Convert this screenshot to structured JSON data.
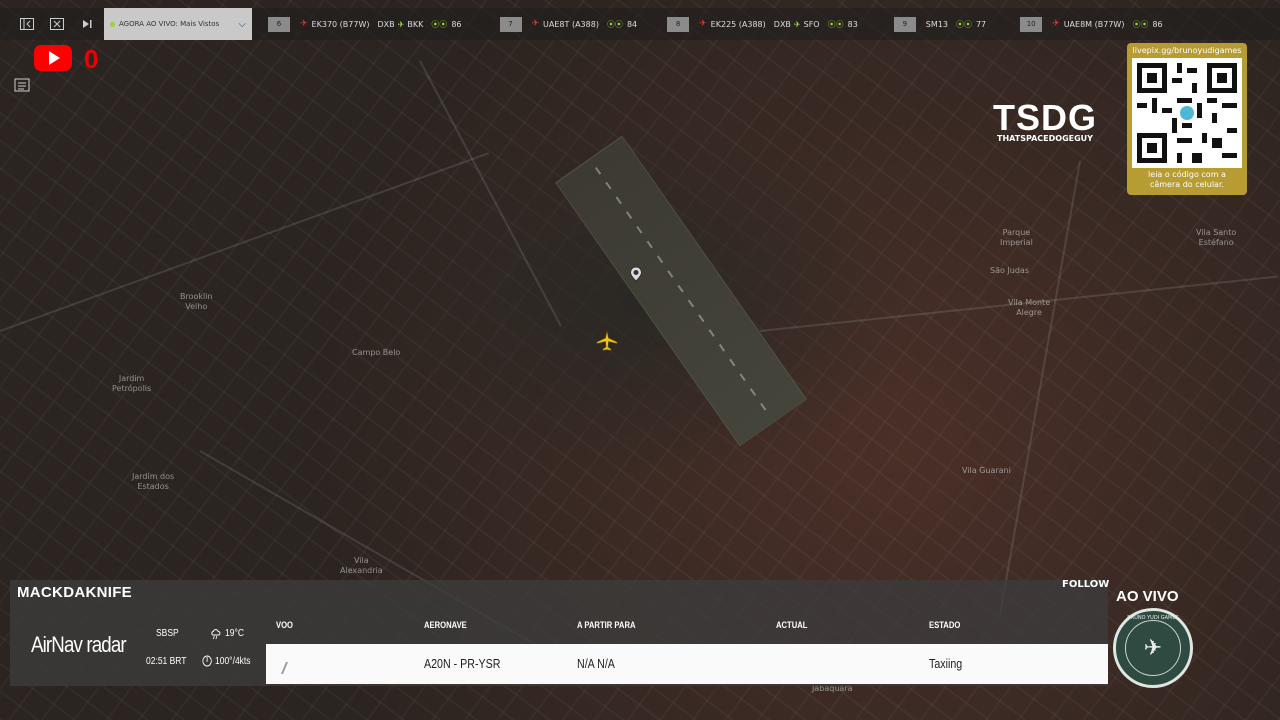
{
  "topbar": {
    "now_live_label": "AGORA AO VIVO: Mais Vistos",
    "flights": [
      {
        "num": "6",
        "code": "EK370 (B77W)",
        "from": "DXB",
        "to": "BKK",
        "count": "86"
      },
      {
        "num": "7",
        "code": "UAE8T (A388)",
        "from": "",
        "to": "",
        "count": "84"
      },
      {
        "num": "8",
        "code": "EK225 (A388)",
        "from": "DXB",
        "to": "SFO",
        "count": "83"
      },
      {
        "num": "9",
        "code": "SM13",
        "from": "",
        "to": "",
        "count": "77"
      },
      {
        "num": "10",
        "code": "UAE8M (B77W)",
        "from": "",
        "to": "",
        "count": "86"
      }
    ]
  },
  "youtube": {
    "count": "0"
  },
  "logo": {
    "main": "TSDG",
    "sub": "THATSPACEDOGEGUY"
  },
  "qr": {
    "url": "livepix.gg/brunoyudigames",
    "caption": "leia o código com a\ncâmera do celular."
  },
  "map_labels": [
    {
      "text": "Brooklin\nVelho"
    },
    {
      "text": "Campo Belo"
    },
    {
      "text": "Jardim\nPetrópolis"
    },
    {
      "text": "Jardim dos\nEstados"
    },
    {
      "text": "Vila\nAlexandria"
    },
    {
      "text": "Parque\nImperial"
    },
    {
      "text": "São Judas"
    },
    {
      "text": "Vila Monte\nAlegre"
    },
    {
      "text": "Vila Guarani"
    },
    {
      "text": "Vila Santo\nEstéfano"
    },
    {
      "text": "Jabaquara"
    }
  ],
  "panel": {
    "callsign": "MACKDAKNIFE",
    "follow": "FOLLOW",
    "brand": "AirNav radar",
    "airport": "SBSP",
    "temp": "19°C",
    "time": "02:51 BRT",
    "wind": "100°/4kts",
    "headers": {
      "flight": "VOO",
      "aircraft": "AERONAVE",
      "from_to": "A PARTIR PARA",
      "actual": "ACTUAL",
      "status": "ESTADO"
    },
    "row": {
      "flight": "",
      "aircraft": "A20N - PR-YSR",
      "from_to": "N/A N/A",
      "actual": "",
      "status": "Taxiing"
    }
  },
  "live": {
    "label": "AO VIVO",
    "badge_text": "BRUNO YUDI GAMES"
  }
}
